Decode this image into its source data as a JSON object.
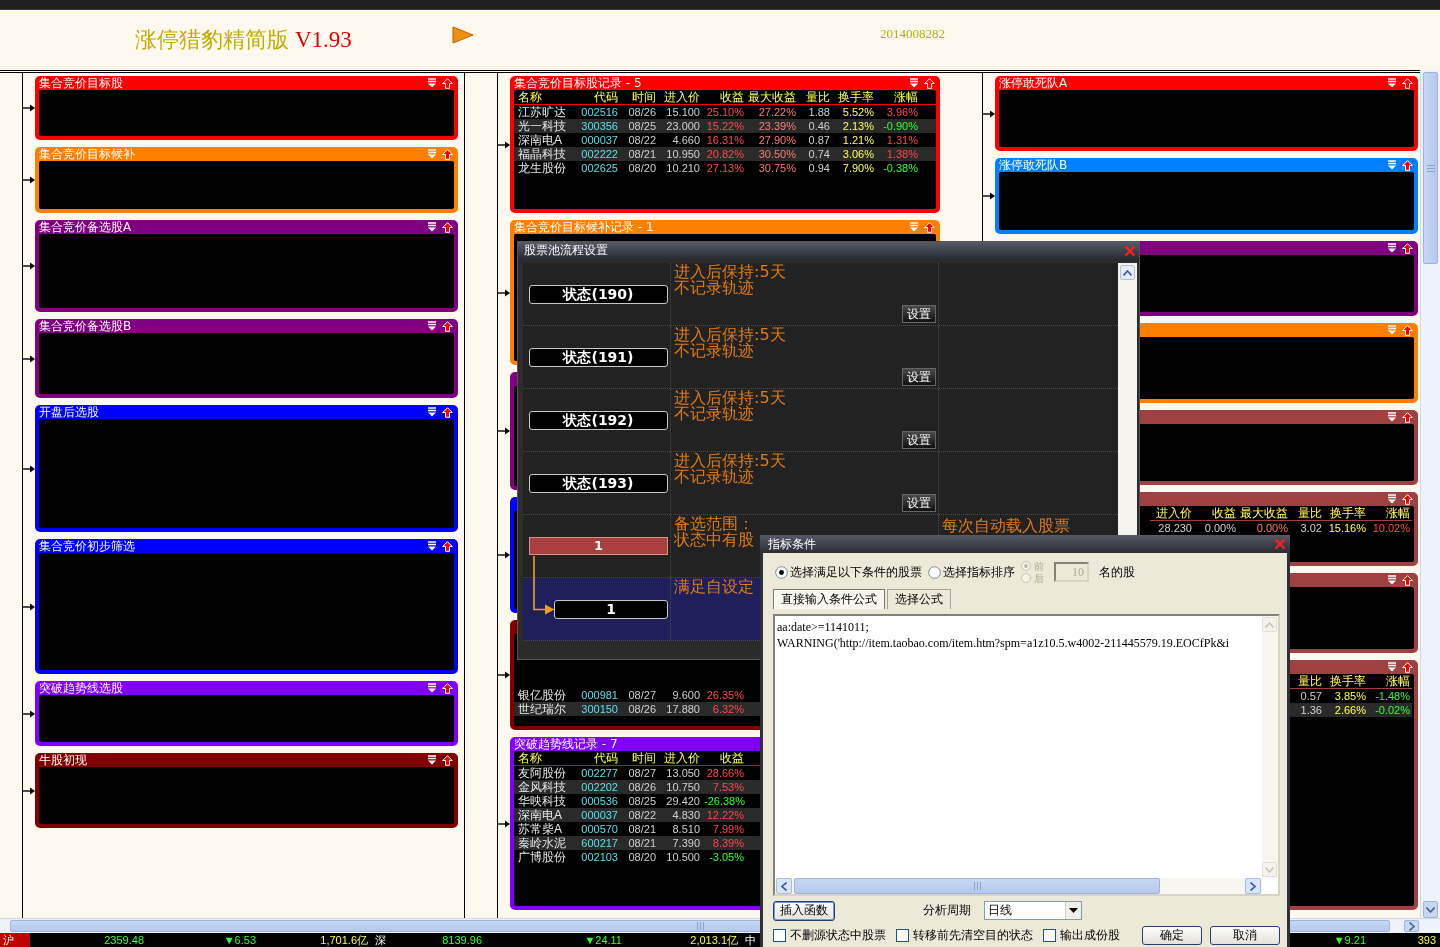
{
  "window": {
    "title": "涨停猎豹精简版",
    "version": "V1.93",
    "date": "2014008282"
  },
  "left_panels": [
    {
      "title": "集合竞价目标股",
      "color": "#ff0000"
    },
    {
      "title": "集合竞价目标候补",
      "color": "#ff8000"
    },
    {
      "title": "集合竞价备选股A",
      "color": "#800080"
    },
    {
      "title": "集合竞价备选股B",
      "color": "#800080"
    },
    {
      "title": "开盘后选股",
      "color": "#0000ff"
    },
    {
      "title": "集合竞价初步筛选",
      "color": "#0000ff"
    },
    {
      "title": "突破趋势线选股",
      "color": "#8000ff"
    },
    {
      "title": "牛股初现",
      "color": "#800000"
    }
  ],
  "middle_panels": [
    {
      "title": "集合竞价目标股记录 - 5",
      "color": "#ff0000",
      "columns": [
        {
          "label": "名称",
          "kind": "name"
        },
        {
          "label": "代码",
          "kind": "code"
        },
        {
          "label": "时间",
          "kind": "time"
        },
        {
          "label": "进入价",
          "kind": "price"
        },
        {
          "label": "收益",
          "kind": "profit"
        },
        {
          "label": "最大收益",
          "kind": "max_profit"
        },
        {
          "label": "量比",
          "kind": "ratio"
        },
        {
          "label": "换手率",
          "kind": "turnover"
        },
        {
          "label": "涨幅",
          "kind": "change"
        }
      ],
      "rows": [
        [
          {
            "text": "江苏旷达",
            "kind": "name"
          },
          {
            "text": "002516",
            "kind": "code"
          },
          {
            "text": "08/26",
            "kind": "time"
          },
          {
            "text": "15.100",
            "kind": "price"
          },
          {
            "text": "25.10%",
            "kind": "profit",
            "falling": false
          },
          {
            "text": "27.22%",
            "kind": "max_profit"
          },
          {
            "text": "1.88",
            "kind": "ratio"
          },
          {
            "text": "5.52%",
            "kind": "turnover"
          },
          {
            "text": "3.96%",
            "kind": "change",
            "falling": false
          }
        ],
        [
          {
            "text": "光一科技",
            "kind": "name"
          },
          {
            "text": "300356",
            "kind": "code"
          },
          {
            "text": "08/25",
            "kind": "time"
          },
          {
            "text": "23.000",
            "kind": "price"
          },
          {
            "text": "15.22%",
            "kind": "profit",
            "falling": false
          },
          {
            "text": "23.39%",
            "kind": "max_profit"
          },
          {
            "text": "0.46",
            "kind": "ratio"
          },
          {
            "text": "2.13%",
            "kind": "turnover"
          },
          {
            "text": "-0.90%",
            "kind": "change",
            "falling": true
          }
        ],
        [
          {
            "text": "深南电A",
            "kind": "name"
          },
          {
            "text": "000037",
            "kind": "code"
          },
          {
            "text": "08/22",
            "kind": "time"
          },
          {
            "text": "4.660",
            "kind": "price"
          },
          {
            "text": "16.31%",
            "kind": "profit",
            "falling": false
          },
          {
            "text": "27.90%",
            "kind": "max_profit"
          },
          {
            "text": "0.87",
            "kind": "ratio"
          },
          {
            "text": "1.21%",
            "kind": "turnover"
          },
          {
            "text": "1.31%",
            "kind": "change",
            "falling": false
          }
        ],
        [
          {
            "text": "福晶科技",
            "kind": "name"
          },
          {
            "text": "002222",
            "kind": "code"
          },
          {
            "text": "08/21",
            "kind": "time"
          },
          {
            "text": "10.950",
            "kind": "price"
          },
          {
            "text": "20.82%",
            "kind": "profit",
            "falling": false
          },
          {
            "text": "30.50%",
            "kind": "max_profit"
          },
          {
            "text": "0.74",
            "kind": "ratio"
          },
          {
            "text": "3.06%",
            "kind": "turnover"
          },
          {
            "text": "1.38%",
            "kind": "change",
            "falling": false
          }
        ],
        [
          {
            "text": "龙生股份",
            "kind": "name"
          },
          {
            "text": "002625",
            "kind": "code"
          },
          {
            "text": "08/20",
            "kind": "time"
          },
          {
            "text": "10.210",
            "kind": "price"
          },
          {
            "text": "27.13%",
            "kind": "profit",
            "falling": false
          },
          {
            "text": "30.75%",
            "kind": "max_profit"
          },
          {
            "text": "0.94",
            "kind": "ratio"
          },
          {
            "text": "7.90%",
            "kind": "turnover"
          },
          {
            "text": "-0.38%",
            "kind": "change",
            "falling": true
          }
        ]
      ]
    },
    {
      "title": "集合竞价目标候补记录 - 1",
      "color": "#ff8000"
    },
    {
      "color": "#800080"
    },
    {
      "color": "#0000ff"
    },
    {
      "color": "#800000",
      "rows": [
        [
          {
            "text": "银亿股份",
            "kind": "name"
          },
          {
            "text": "000981",
            "kind": "code"
          },
          {
            "text": "08/27",
            "kind": "time"
          },
          {
            "text": "9.600",
            "kind": "price"
          },
          {
            "text": "26.35%",
            "kind": "profit",
            "falling": false
          }
        ],
        [
          {
            "text": "世纪瑞尔",
            "kind": "name"
          },
          {
            "text": "300150",
            "kind": "code"
          },
          {
            "text": "08/26",
            "kind": "time"
          },
          {
            "text": "17.880",
            "kind": "price"
          },
          {
            "text": "6.32%",
            "kind": "profit",
            "falling": false
          }
        ]
      ]
    },
    {
      "title": "突破趋势线记录 - 7",
      "color": "#8000ff",
      "columns": [
        {
          "label": "名称",
          "kind": "name"
        },
        {
          "label": "代码",
          "kind": "code"
        },
        {
          "label": "时间",
          "kind": "time"
        },
        {
          "label": "进入价",
          "kind": "price"
        },
        {
          "label": "收益",
          "kind": "profit"
        }
      ],
      "rows": [
        [
          {
            "text": "友阿股份",
            "kind": "name"
          },
          {
            "text": "002277",
            "kind": "code"
          },
          {
            "text": "08/27",
            "kind": "time"
          },
          {
            "text": "13.050",
            "kind": "price"
          },
          {
            "text": "28.66%",
            "kind": "profit",
            "falling": false
          }
        ],
        [
          {
            "text": "金风科技",
            "kind": "name"
          },
          {
            "text": "002202",
            "kind": "code"
          },
          {
            "text": "08/26",
            "kind": "time"
          },
          {
            "text": "10.750",
            "kind": "price"
          },
          {
            "text": "7.53%",
            "kind": "profit",
            "falling": false
          }
        ],
        [
          {
            "text": "华映科技",
            "kind": "name"
          },
          {
            "text": "000536",
            "kind": "code"
          },
          {
            "text": "08/25",
            "kind": "time"
          },
          {
            "text": "29.420",
            "kind": "price"
          },
          {
            "text": "-26.38%",
            "kind": "profit",
            "falling": true
          }
        ],
        [
          {
            "text": "深南电A",
            "kind": "name"
          },
          {
            "text": "000037",
            "kind": "code"
          },
          {
            "text": "08/22",
            "kind": "time"
          },
          {
            "text": "4.830",
            "kind": "price"
          },
          {
            "text": "12.22%",
            "kind": "profit",
            "falling": false
          }
        ],
        [
          {
            "text": "苏常柴A",
            "kind": "name"
          },
          {
            "text": "000570",
            "kind": "code"
          },
          {
            "text": "08/21",
            "kind": "time"
          },
          {
            "text": "8.510",
            "kind": "price"
          },
          {
            "text": "7.99%",
            "kind": "profit",
            "falling": false
          }
        ],
        [
          {
            "text": "秦岭水泥",
            "kind": "name"
          },
          {
            "text": "600217",
            "kind": "code"
          },
          {
            "text": "08/21",
            "kind": "time"
          },
          {
            "text": "7.390",
            "kind": "price"
          },
          {
            "text": "8.39%",
            "kind": "profit",
            "falling": false
          }
        ],
        [
          {
            "text": "广博股份",
            "kind": "name"
          },
          {
            "text": "002103",
            "kind": "code"
          },
          {
            "text": "08/20",
            "kind": "time"
          },
          {
            "text": "10.500",
            "kind": "price"
          },
          {
            "text": "-3.05%",
            "kind": "profit",
            "falling": true
          }
        ]
      ]
    }
  ],
  "right_panels": [
    {
      "title": "涨停敢死队A",
      "color": "#ff0000"
    },
    {
      "title": "涨停敢死队B",
      "color": "#0080ff"
    },
    {
      "color": "#800080"
    },
    {
      "color": "#ff8000"
    },
    {
      "color": "#a04040"
    },
    {
      "color": "#a04040",
      "columns": [
        {
          "label": "进入价",
          "kind": "price"
        },
        {
          "label": "收益",
          "kind": "profit"
        },
        {
          "label": "最大收益",
          "kind": "max_profit"
        },
        {
          "label": "量比",
          "kind": "ratio"
        },
        {
          "label": "换手率",
          "kind": "turnover"
        },
        {
          "label": "涨幅",
          "kind": "change"
        }
      ],
      "rows": [
        [
          {
            "text": "28.230",
            "kind": "price"
          },
          {
            "text": "0.00%",
            "kind": "profit"
          },
          {
            "text": "0.00%",
            "kind": "max_profit"
          },
          {
            "text": "3.02",
            "kind": "ratio"
          },
          {
            "text": "15.16%",
            "kind": "turnover"
          },
          {
            "text": "10.02%",
            "kind": "change",
            "falling": false
          }
        ]
      ]
    },
    {
      "color": "#a04040"
    },
    {
      "color": "#a04040",
      "columns": [
        {
          "label": "量比",
          "kind": "ratio"
        },
        {
          "label": "换手率",
          "kind": "turnover"
        },
        {
          "label": "涨幅",
          "kind": "change"
        }
      ],
      "rows": [
        [
          {
            "text": "0.57",
            "kind": "ratio"
          },
          {
            "text": "3.85%",
            "kind": "turnover"
          },
          {
            "text": "-1.48%",
            "kind": "change",
            "falling": true
          }
        ],
        [
          {
            "text": "1.36",
            "kind": "ratio"
          },
          {
            "text": "2.66%",
            "kind": "turnover"
          },
          {
            "text": "-0.02%",
            "kind": "change",
            "falling": true
          }
        ]
      ]
    }
  ],
  "pool_dialog": {
    "title": "股票池流程设置",
    "rows": [
      {
        "kind": "state",
        "state": "状态(190)",
        "lines": [
          "进入后保持:5天",
          "不记录轨迹"
        ],
        "button": "设置",
        "selected": false
      },
      {
        "kind": "state",
        "state": "状态(191)",
        "lines": [
          "进入后保持:5天",
          "不记录轨迹"
        ],
        "button": "设置",
        "selected": false
      },
      {
        "kind": "state",
        "state": "状态(192)",
        "lines": [
          "进入后保持:5天",
          "不记录轨迹"
        ],
        "button": "设置",
        "selected": false
      },
      {
        "kind": "state",
        "state": "状态(193)",
        "lines": [
          "进入后保持:5天",
          "不记录轨迹"
        ],
        "button": "设置",
        "selected": false
      },
      {
        "kind": "range",
        "state": "1",
        "lines": [
          "备选范围：",
          "状态中有股"
        ],
        "note": "每次自动载入股票",
        "selected": false
      },
      {
        "kind": "target",
        "state": "1",
        "lines": [
          "满足自设定"
        ],
        "selected": true
      }
    ]
  },
  "indicator_dialog": {
    "title": "指标条件",
    "modes": [
      {
        "label": "选择满足以下条件的股票",
        "selected": true
      },
      {
        "label": "选择指标排序",
        "selected": false
      }
    ],
    "order": {
      "disabled": true,
      "options": [
        {
          "label": "前",
          "selected": true
        },
        {
          "label": "后",
          "selected": false
        }
      ]
    },
    "count": {
      "value": "10",
      "disabled": true
    },
    "count_suffix": "名的股",
    "tabs": [
      {
        "label": "直接输入条件公式",
        "selected": true
      },
      {
        "label": "选择公式",
        "selected": false
      }
    ],
    "formula_lines": [
      "aa:date>=1141011;",
      "WARNING('http://item.taobao.com/item.htm?spm=a1z10.5.w4002-211445579.19.EOCfPk&i"
    ],
    "insert_button": "插入函数",
    "period": {
      "label": "分析周期",
      "value": "日线"
    },
    "options": [
      {
        "label": "不删源状态中股票",
        "checked": false
      },
      {
        "label": "转移前先清空目的状态",
        "checked": false
      },
      {
        "label": "输出成份股",
        "checked": false
      }
    ],
    "buttons": [
      "确定",
      "取消"
    ]
  },
  "status_bar": [
    {
      "kind": "market",
      "text": "沪"
    },
    {
      "kind": "index",
      "text": "2359.48"
    },
    {
      "kind": "change",
      "text": "▼6.53"
    },
    {
      "kind": "amount",
      "text": "1,701.6亿"
    },
    {
      "kind": "market",
      "text": "深"
    },
    {
      "kind": "index",
      "text": "8139.96"
    },
    {
      "kind": "change",
      "text": "▼24.11"
    },
    {
      "kind": "amount",
      "text": "2,013.1亿"
    },
    {
      "kind": "market",
      "text": "中"
    },
    {
      "kind": "change",
      "text": "▼9.21"
    },
    {
      "kind": "amount",
      "text": "393"
    }
  ]
}
